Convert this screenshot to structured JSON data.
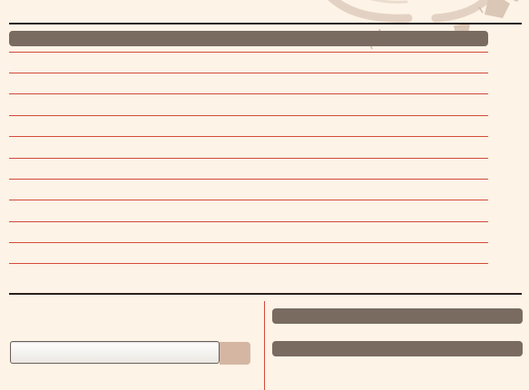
{
  "colors": {
    "background": "#fdf3e6",
    "bar": "#7a6b61",
    "rule_dark": "#2a1f1c",
    "rule_red": "#d34a3a",
    "button": "#d4b6a3"
  },
  "header_bar": {
    "label": ""
  },
  "ruled_lines": [
    {
      "text": ""
    },
    {
      "text": ""
    },
    {
      "text": ""
    },
    {
      "text": ""
    },
    {
      "text": ""
    },
    {
      "text": ""
    },
    {
      "text": ""
    },
    {
      "text": ""
    },
    {
      "text": ""
    },
    {
      "text": ""
    },
    {
      "text": ""
    }
  ],
  "bottom_left": {
    "input": {
      "value": "",
      "placeholder": ""
    },
    "button_label": ""
  },
  "bottom_right": {
    "bars": [
      {
        "label": ""
      },
      {
        "label": ""
      }
    ]
  },
  "decoration": {
    "icon": "coffee-stain-icon"
  }
}
